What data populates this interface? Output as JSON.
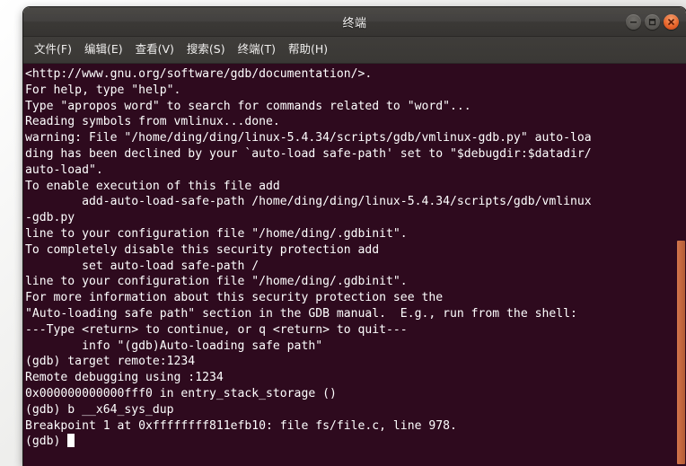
{
  "window": {
    "title": "终端",
    "controls": [
      {
        "name": "minimize",
        "label": "最小化"
      },
      {
        "name": "maximize",
        "label": "最大化"
      },
      {
        "name": "close",
        "label": "关闭"
      }
    ]
  },
  "menubar": {
    "items": [
      {
        "label": "文件(F)"
      },
      {
        "label": "编辑(E)"
      },
      {
        "label": "查看(V)"
      },
      {
        "label": "搜索(S)"
      },
      {
        "label": "终端(T)"
      },
      {
        "label": "帮助(H)"
      }
    ]
  },
  "terminal": {
    "foreground": "#ffffff",
    "background": "#2e0a1e",
    "scrollbar_color": "#c4683f",
    "prompt": "(gdb)",
    "cursor_visible": true,
    "lines": [
      "<http://www.gnu.org/software/gdb/documentation/>.",
      "For help, type \"help\".",
      "Type \"apropos word\" to search for commands related to \"word\"...",
      "Reading symbols from vmlinux...done.",
      "warning: File \"/home/ding/ding/linux-5.4.34/scripts/gdb/vmlinux-gdb.py\" auto-loa",
      "ding has been declined by your `auto-load safe-path' set to \"$debugdir:$datadir/",
      "auto-load\".",
      "To enable execution of this file add",
      "        add-auto-load-safe-path /home/ding/ding/linux-5.4.34/scripts/gdb/vmlinux",
      "-gdb.py",
      "line to your configuration file \"/home/ding/.gdbinit\".",
      "To completely disable this security protection add",
      "        set auto-load safe-path /",
      "line to your configuration file \"/home/ding/.gdbinit\".",
      "For more information about this security protection see the",
      "\"Auto-loading safe path\" section in the GDB manual.  E.g., run from the shell:",
      "---Type <return> to continue, or q <return> to quit---",
      "        info \"(gdb)Auto-loading safe path\"",
      "(gdb) target remote:1234",
      "Remote debugging using :1234",
      "0x000000000000fff0 in entry_stack_storage ()",
      "(gdb) b __x64_sys_dup",
      "Breakpoint 1 at 0xffffffff811efb10: file fs/file.c, line 978."
    ],
    "last_line_prompt": "(gdb) "
  }
}
